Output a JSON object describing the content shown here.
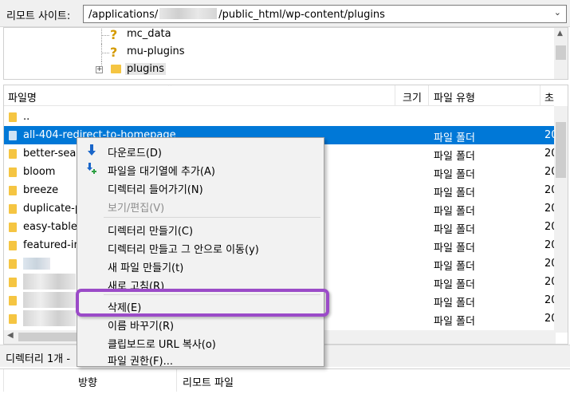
{
  "remote_site": {
    "label": "리모트 사이트:",
    "path_prefix": "/applications/",
    "path_suffix": "/public_html/wp-content/plugins"
  },
  "tree": {
    "items": [
      {
        "name": "mc_data",
        "icon": "question-icon"
      },
      {
        "name": "mu-plugins",
        "icon": "question-icon"
      },
      {
        "name": "plugins",
        "icon": "folder-icon",
        "expander": "+"
      }
    ]
  },
  "file_list": {
    "columns": {
      "name": "파일명",
      "size": "크기",
      "type": "파일 유형",
      "modified": "초"
    },
    "rows": [
      {
        "name": "..",
        "type": "",
        "modified": ""
      },
      {
        "name": "all-404-redirect-to-homepage",
        "type": "파일 폴더",
        "modified": "20"
      },
      {
        "name": "better-sear",
        "type": "파일 폴더",
        "modified": "20"
      },
      {
        "name": "bloom",
        "type": "파일 폴더",
        "modified": "20"
      },
      {
        "name": "breeze",
        "type": "파일 폴더",
        "modified": "20"
      },
      {
        "name": "duplicate-p",
        "type": "파일 폴더",
        "modified": "20"
      },
      {
        "name": "easy-table-",
        "type": "파일 폴더",
        "modified": "20"
      },
      {
        "name": "featured-im",
        "type": "파일 폴더",
        "modified": "20"
      },
      {
        "name": "",
        "type": "파일 폴더",
        "modified": "20"
      },
      {
        "name": "",
        "type": "파일 폴더",
        "modified": "20"
      },
      {
        "name": "",
        "type": "파일 폴더",
        "modified": "20"
      },
      {
        "name": "",
        "type": "파일 폴더",
        "modified": "20"
      }
    ]
  },
  "status_bar": {
    "text": "디렉터리 1개 -"
  },
  "queue": {
    "columns": {
      "direction": "방향",
      "remote_file": "리모트 파일"
    }
  },
  "context_menu": {
    "items": [
      {
        "label": "다운로드(D)",
        "icon": "download-arrow-icon"
      },
      {
        "label": "파일을 대기열에 추가(A)",
        "icon": "add-to-queue-icon"
      },
      {
        "label": "디렉터리 들어가기(N)"
      },
      {
        "label": "보기/편집(V)",
        "disabled": true
      },
      {
        "label": "디렉터리 만들기(C)"
      },
      {
        "label": "디렉터리 만들고 그 안으로 이동(y)"
      },
      {
        "label": "새 파일 만들기(t)"
      },
      {
        "label": "새로 고침(R)"
      },
      {
        "label": "삭제(E)"
      },
      {
        "label": "이름 바꾸기(R)"
      },
      {
        "label": "클립보드로 URL 복사(o)"
      },
      {
        "label": "파일 권한(F)..."
      }
    ]
  },
  "colors": {
    "selection": "#0078d7",
    "highlight_outline": "#9b4bc8",
    "folder": "#f5c542"
  }
}
